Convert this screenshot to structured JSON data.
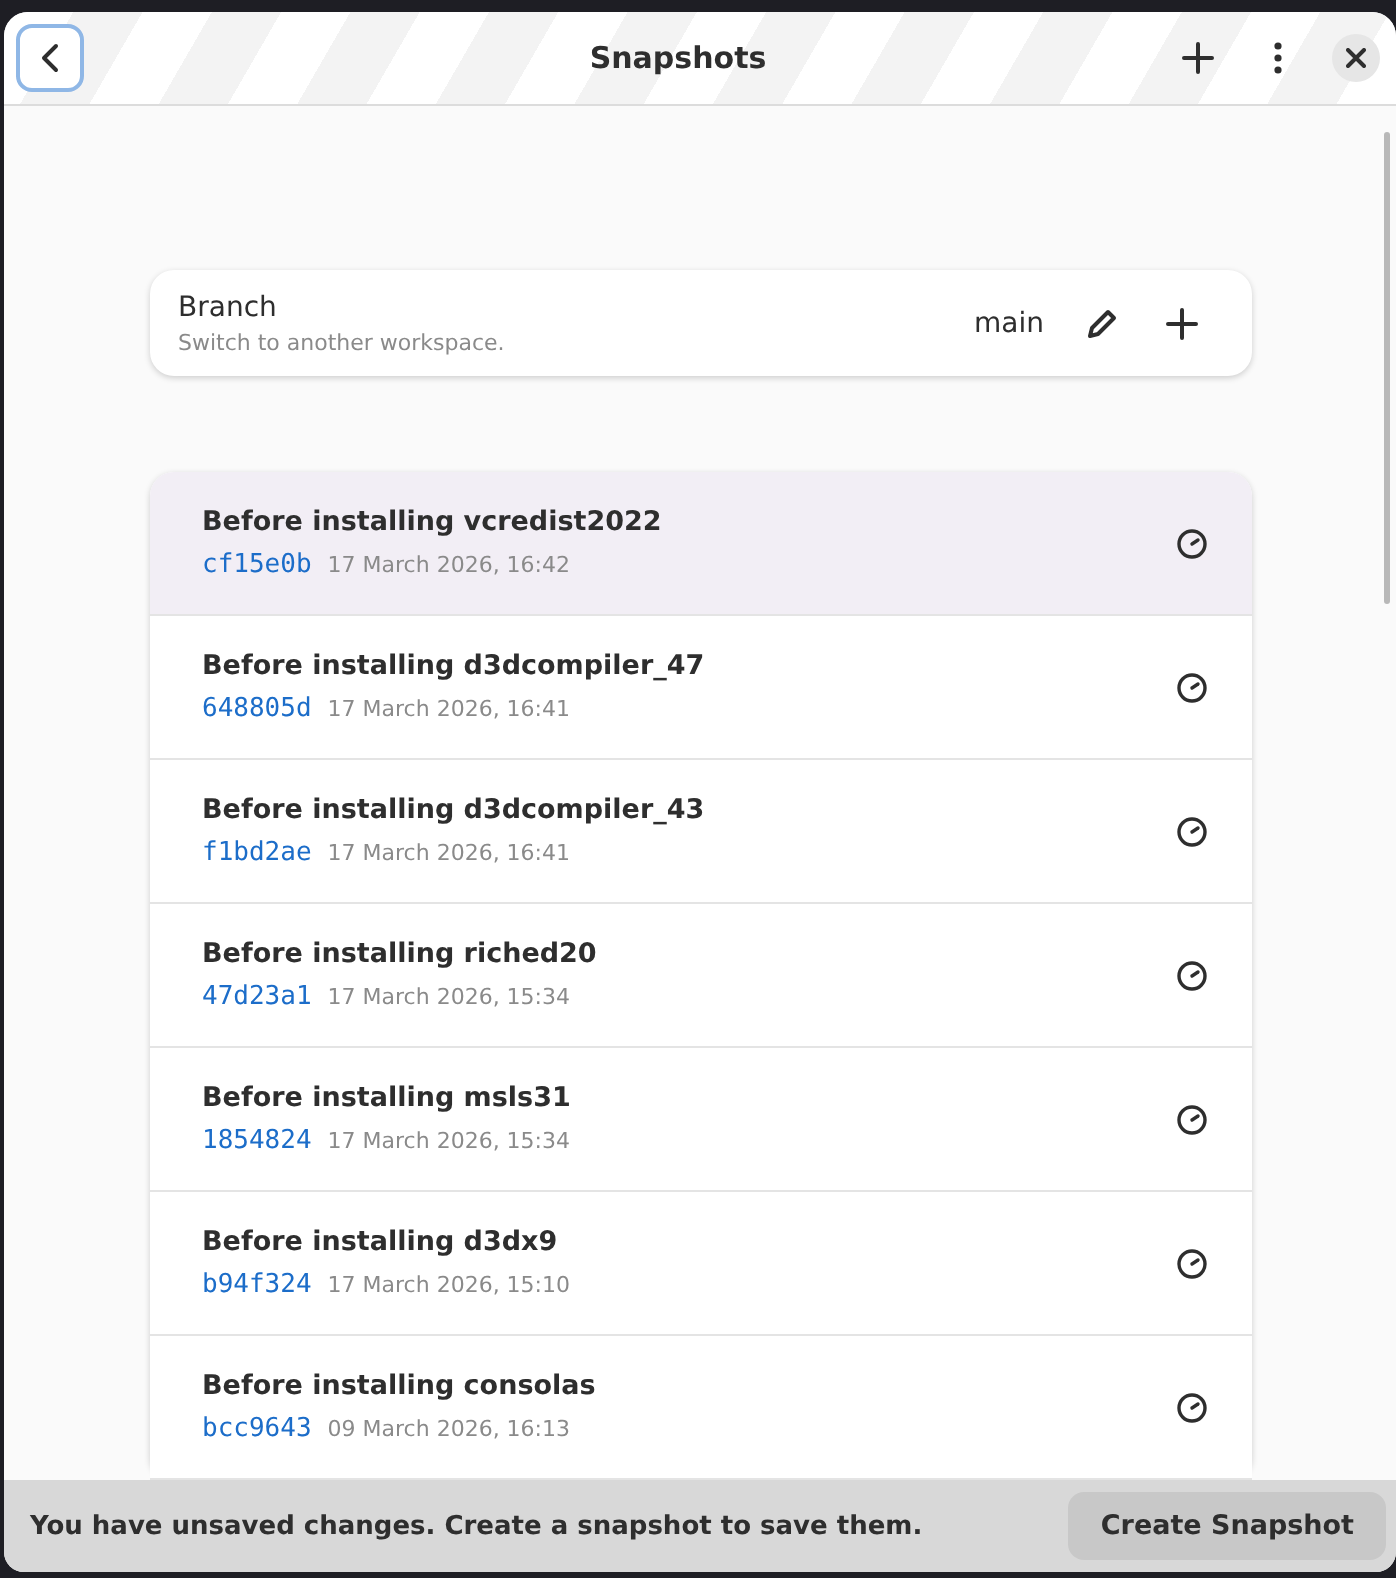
{
  "header": {
    "title": "Snapshots"
  },
  "branch": {
    "label": "Branch",
    "subtitle": "Switch to another workspace.",
    "value": "main"
  },
  "snapshots": [
    {
      "title": "Before installing vcredist2022",
      "hash": "cf15e0b",
      "date": "17 March 2026, 16:42",
      "selected": true
    },
    {
      "title": "Before installing d3dcompiler_47",
      "hash": "648805d",
      "date": "17 March 2026, 16:41",
      "selected": false
    },
    {
      "title": "Before installing d3dcompiler_43",
      "hash": "f1bd2ae",
      "date": "17 March 2026, 16:41",
      "selected": false
    },
    {
      "title": "Before installing riched20",
      "hash": "47d23a1",
      "date": "17 March 2026, 15:34",
      "selected": false
    },
    {
      "title": "Before installing msls31",
      "hash": "1854824",
      "date": "17 March 2026, 15:34",
      "selected": false
    },
    {
      "title": "Before installing d3dx9",
      "hash": "b94f324",
      "date": "17 March 2026, 15:10",
      "selected": false
    },
    {
      "title": "Before installing consolas",
      "hash": "bcc9643",
      "date": "09 March 2026, 16:13",
      "selected": false
    }
  ],
  "footer": {
    "message": "You have unsaved changes. Create a snapshot to save them.",
    "button": "Create Snapshot"
  }
}
